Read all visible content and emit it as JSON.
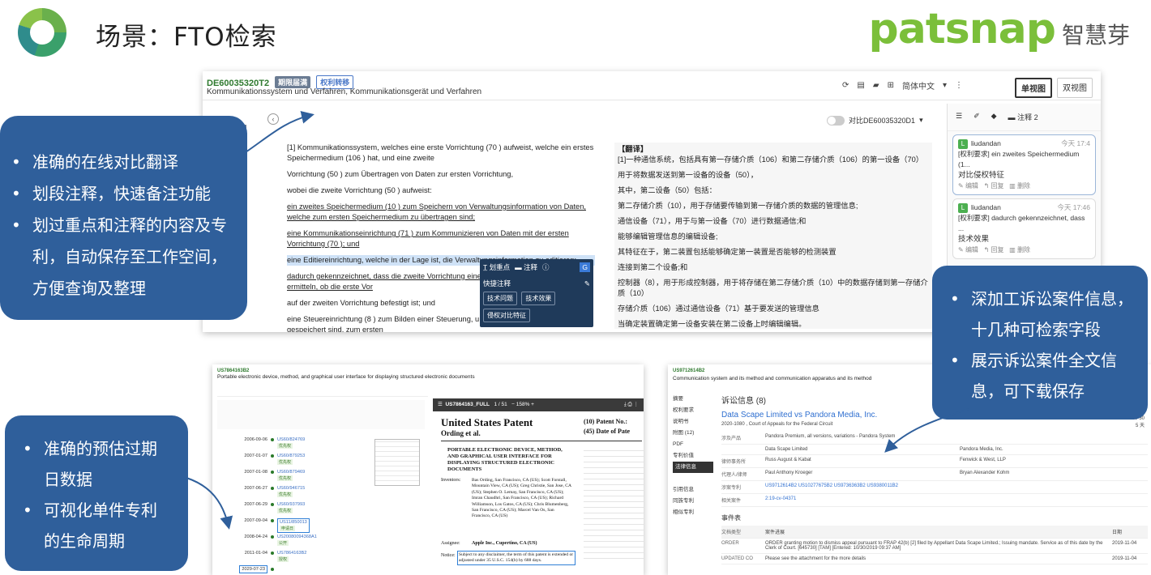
{
  "header": {
    "title": "场景：FTO检索",
    "brand_en": "patsnap",
    "brand_zh": "智慧芽",
    "brand_color": "#7bbf3a"
  },
  "callouts": {
    "left_top": [
      "准确的在线对比翻译",
      "划段注释，快速备注功能",
      "划过重点和注释的内容及专利，自动保存至工作空间，方便查询及整理"
    ],
    "right": [
      "深加工诉讼案件信息，十几种可检索字段",
      "展示诉讼案件全文信息，可下载保存"
    ],
    "left_bottom": [
      "准确的预估过期日数据",
      "可视化单件专利的生命周期"
    ],
    "color": "#2f5f9b"
  },
  "shot1": {
    "patent_id": "DE60035320T2",
    "badge_status": "期限届满",
    "badge_transfer": "权利转移",
    "subtitle": "Kommunikationssystem und Verfahren, Kommunikationsgerät und Verfahren",
    "language": "简体中文",
    "view_single": "单视图",
    "view_double": "双视图",
    "compare_label": "对比DE60035320D1",
    "german": [
      "[1] Kommunikationssystem, welches eine erste Vorrichtung (70 ) aufweist, welche ein erstes Speichermedium (106 ) hat, und eine zweite",
      "Vorrichtung (50 ) zum Übertragen von Daten zur ersten Vorrichtung,",
      "wobei die zweite Vorrichtung (50 ) aufweist:",
      "ein zweites Speichermedium (10 ) zum Speichern von Verwaltungsinformation von Daten, welche zum ersten Speichermedium zu übertragen sind;",
      "eine Kommunikationseinrichtung (71 ) zum Kommunizieren von Daten mit der ersten Vorrichtung (70 ); und",
      "eine Editiereinrichtung, welche in der Lage ist, die Verwaltungsinformation zu editieren;",
      "dadurch gekennzeichnet, dass die zweite Vorrichtung eine aufweist, die in der Lage ist, zu ermitteln, ob die erste Vor",
      "auf der zweiten Vorrichtung befestigt ist; und",
      "eine Steuereinrichtung (8 ) zum Bilden einer Steuerung, u Speichermedium (10 ) gespeichert sind, zum ersten"
    ],
    "chinese_title": "【翻译】",
    "chinese": [
      "[1]一种通信系统，包括具有第一存储介质（106）和第二存储介质（106）的第一设备（70）",
      "用于将数据发送到第一设备的设备（50），",
      "其中，第二设备（50）包括：",
      "第二存储介质（10），用于存储要传输到第一存储介质的数据的管理信息;",
      "通信设备（71），用于与第一设备（70）进行数据通信;和",
      "能够编辑管理信息的编辑设备;",
      "其特征在于，第二装置包括能够确定第一装置是否能够的检测装置",
      "连接到第二个设备;和",
      "控制器（8），用于形成控制器，用于将存储在第二存储介质（10）中的数据存储到第一存储介质（10）",
      "存储介质（106）通过通信设备（71）基于要发送的管理信息",
      "当确定装置确定第一设备安装在第二设备上时编辑编辑。"
    ],
    "popup": {
      "highlight": "划重点",
      "annotate": "注释",
      "quick_note": "快捷注释",
      "tag1": "技术问题",
      "tag2": "技术效果",
      "tag3": "侵权对比特征"
    },
    "side_tab_note": "注释 2",
    "notes": [
      {
        "user": "liudandan",
        "time": "今天 17:4",
        "ref": "[权利要求] ein zweites Speichermedium (1...",
        "text": "对比侵权特征",
        "edit": "编辑",
        "reply": "回复",
        "delete": "删除"
      },
      {
        "user": "liudandan",
        "time": "今天 17:46",
        "ref": "[权利要求] dadurch gekennzeichnet, dass ...",
        "text": "技术效果",
        "edit": "编辑",
        "reply": "回复",
        "delete": "删除"
      }
    ]
  },
  "shot2": {
    "patent_id": "US7864163B2",
    "subtitle": "Portable electronic device, method, and graphical user interface for displaying structured electronic documents",
    "pdf_file": "US7864163_FULL",
    "pdf_page": "1 / 51",
    "pdf_zoom": "158%",
    "pdf_title": "United States Patent",
    "pdf_authors": "Ording et al.",
    "pdf_patent_no": "(10) Patent No.:",
    "pdf_date": "(45) Date of Pate",
    "pdf_invention": "PORTABLE ELECTRONIC DEVICE, METHOD, AND GRAPHICAL USER INTERFACE FOR DISPLAYING STRUCTURED ELECTRONIC DOCUMENTS",
    "pdf_inventors_label": "Inventors:",
    "pdf_inventors": "Bas Ording, San Francisco, CA (US); Scott Forstall, Mountain View, CA (US); Greg Christie, San Jose, CA (US); Stephen O. Lemay, San Francisco, CA (US); Imran Chaudhri, San Francisco, CA (US); Richard Williamson, Los Gatos, CA (US); Chris Blumenberg, San Francisco, CA (US); Marcel Van Os, San Francisco, CA (US)",
    "pdf_assignee_label": "Assignee:",
    "pdf_assignee": "Apple Inc., Cupertino, CA (US)",
    "pdf_notice_label": "Notice:",
    "pdf_notice": "Subject to any disclaimer, the term of this patent is extended or adjusted under 35 U.S.C. 154(b) by 688 days.",
    "timeline": [
      {
        "date": "2006-09-06",
        "num": "US60/824769",
        "tag": "优先权"
      },
      {
        "date": "2007-01-07",
        "num": "US60/879253",
        "tag": "优先权"
      },
      {
        "date": "2007-01-08",
        "num": "US60/879469",
        "tag": "优先权"
      },
      {
        "date": "2007-06-27",
        "num": "US60/946715",
        "tag": "优先权"
      },
      {
        "date": "2007-06-29",
        "num": "US60/937993",
        "tag": "优先权"
      },
      {
        "date": "2007-09-04",
        "num": "US11/850013",
        "tag": "申请日"
      },
      {
        "date": "2008-04-24",
        "num": "US20080094368A1",
        "tag": "公开"
      },
      {
        "date": "2011-01-04",
        "num": "US7864163B2",
        "tag": "授权"
      },
      {
        "date": "2029-07-23",
        "num": "",
        "tag": ""
      }
    ]
  },
  "shot3": {
    "patent_id": "US9712614B2",
    "subtitle": "Communication system and its method and communication apparatus and its method",
    "nav": [
      "摘要",
      "权利要求",
      "说明书",
      "附图 (12)",
      "PDF",
      "专利价值",
      "法律信息",
      "引用信息",
      "同族专利",
      "相似专利"
    ],
    "section": "诉讼信息 (8)",
    "case_title": "Data Scape Limited vs Pandora Media, Inc.",
    "case_sub": "2020-1080 , Court of Appeals for the Federal Circuit",
    "date_right": "2019-10-30",
    "days_right": "5 天",
    "rows": [
      {
        "k": "涉及产品",
        "v1": "Pandora Premium, all versions, variations - Pandora System",
        "v2": ""
      },
      {
        "k": "",
        "v1": "Data Scape Limited",
        "v2": "Pandora Media, Inc."
      },
      {
        "k": "律师事务所",
        "v1": "Russ August & Kabat",
        "v2": "Fenwick & West, LLP"
      },
      {
        "k": "代理人/律师",
        "v1": "Paul Anthony Kroeger",
        "v2": "Bryan Alexander Kohm"
      },
      {
        "k": "涉案专利",
        "v1": "US9712614B2   US10277675B2   US9736363B2   US9380011B2",
        "v2": ""
      },
      {
        "k": "相关案件",
        "v1": "2:19-cv-04371",
        "v2": ""
      }
    ],
    "events_title": "事件表",
    "events_head": [
      "文档类型",
      "案件进展",
      "日期"
    ],
    "events": [
      {
        "type": "ORDER",
        "desc": "ORDER granting motion to dismiss appeal pursuant to FRAP 42(b) [2] filed by Appellant Data Scape Limited.; Issuing mandate. Service as of this date by the Clerk of Court. [645730] [TAM] [Entered: 10/30/2019 09:37 AM]",
        "date": "2019-11-04"
      },
      {
        "type": "UPDATED CO",
        "desc": "Please see the attachment for the more details",
        "date": "2019-11-04"
      }
    ]
  }
}
